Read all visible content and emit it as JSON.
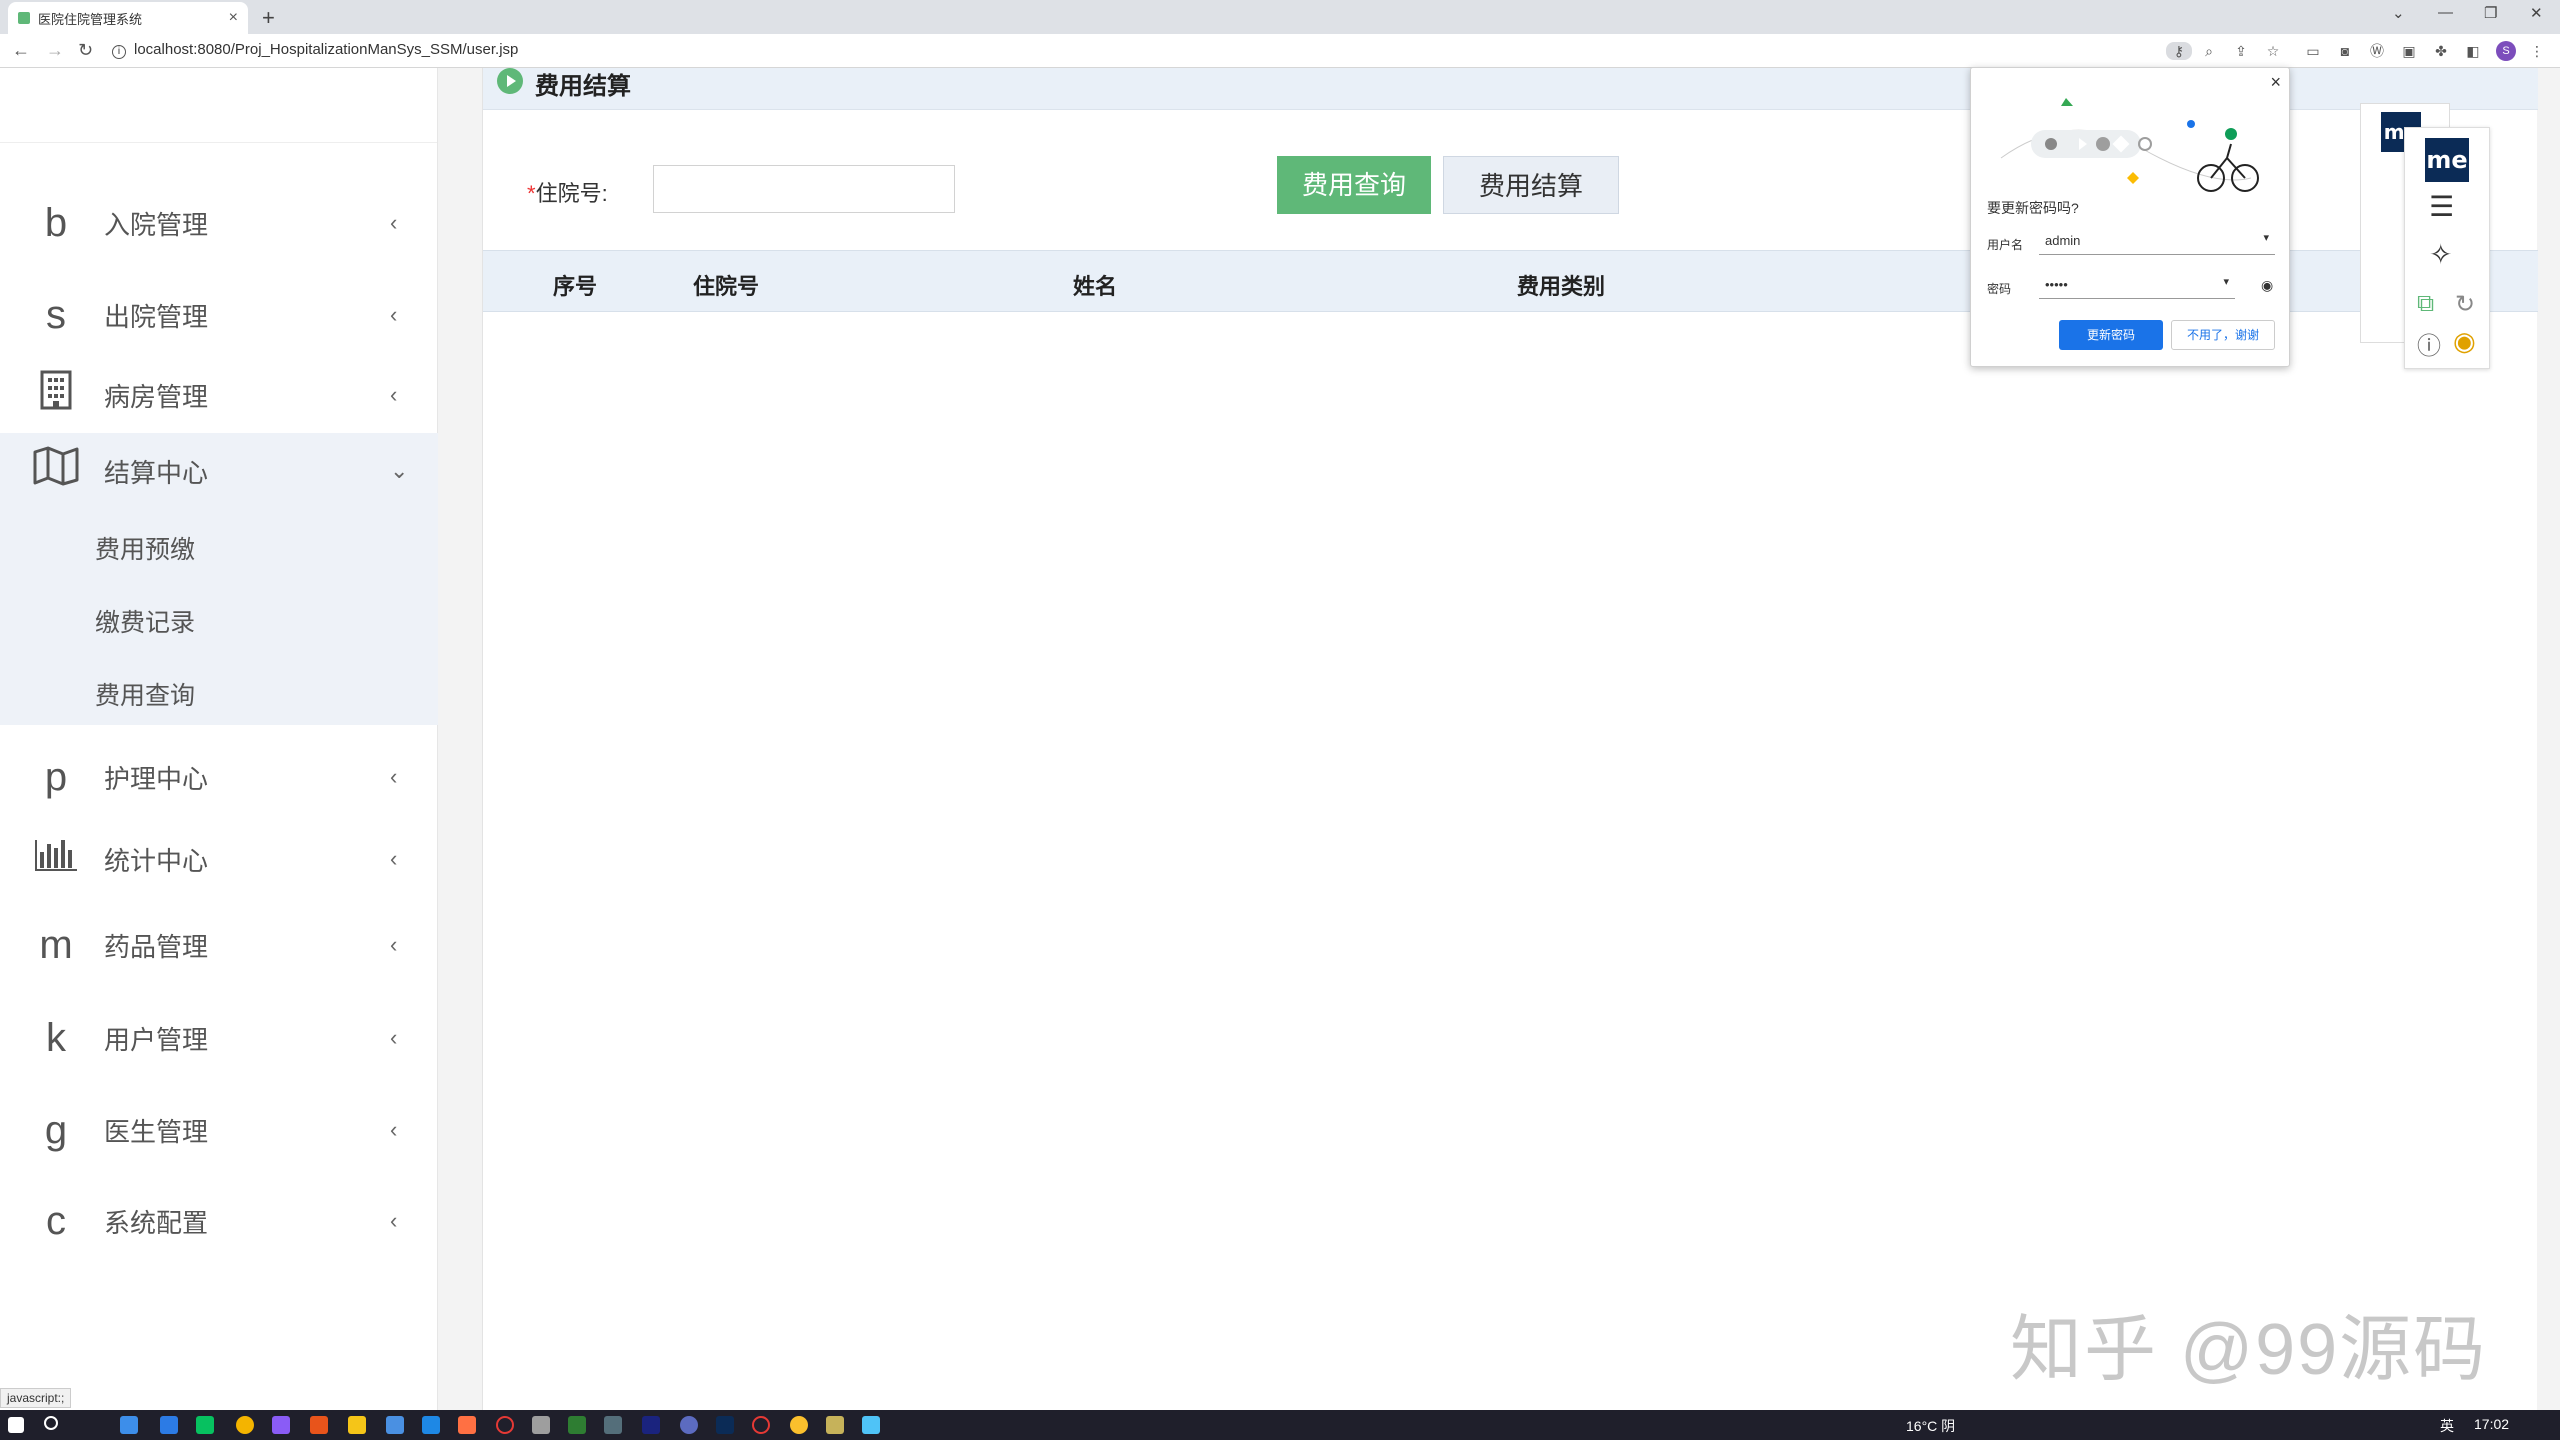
{
  "browser": {
    "tab_title": "医院住院管理系统",
    "tab_close": "×",
    "new_tab": "+",
    "url": "localhost:8080/Proj_HospitalizationManSys_SSM/user.jsp",
    "profile_initial": "S",
    "window_controls": [
      "⌄",
      "—",
      "❐",
      "✕"
    ]
  },
  "sidebar": {
    "items": [
      {
        "icon": "b",
        "label": "入院管理",
        "arrow": "‹"
      },
      {
        "icon": "s",
        "label": "出院管理",
        "arrow": "‹"
      },
      {
        "icon": "building-icon",
        "label": "病房管理",
        "arrow": "‹"
      },
      {
        "icon": "map-icon",
        "label": "结算中心",
        "arrow": "⌄"
      },
      {
        "icon": "p",
        "label": "护理中心",
        "arrow": "‹"
      },
      {
        "icon": "bar-chart-icon",
        "label": "统计中心",
        "arrow": "‹"
      },
      {
        "icon": "m",
        "label": "药品管理",
        "arrow": "‹"
      },
      {
        "icon": "k",
        "label": "用户管理",
        "arrow": "‹"
      },
      {
        "icon": "g",
        "label": "医生管理",
        "arrow": "‹"
      },
      {
        "icon": "c",
        "label": "系统配置",
        "arrow": "‹"
      }
    ],
    "settle_sub": [
      "费用预缴",
      "缴费记录",
      "费用查询"
    ]
  },
  "main": {
    "title": "费用结算",
    "form": {
      "required_mark": "*",
      "label": "住院号:",
      "value": ""
    },
    "buttons": {
      "query": "费用查询",
      "settle": "费用结算"
    },
    "table": {
      "headers": [
        "序号",
        "住院号",
        "姓名",
        "费用类别"
      ],
      "rows": []
    }
  },
  "password_popup": {
    "close": "×",
    "title": "要更新密码吗?",
    "username_label": "用户名",
    "username_value": "admin",
    "password_label": "密码",
    "password_value": "•••••",
    "update_button": "更新密码",
    "dismiss_button": "不用了，谢谢"
  },
  "extension": {
    "logo": "me"
  },
  "watermark": "知乎 @99源码",
  "status_text": "javascript:;",
  "system_tray": {
    "weather": "16°C 阴",
    "lang": "英",
    "time": "17:02"
  },
  "colors": {
    "accent_green": "#5fb878",
    "header_bg": "#e9f0f8",
    "chrome_blue": "#1a73e8"
  }
}
